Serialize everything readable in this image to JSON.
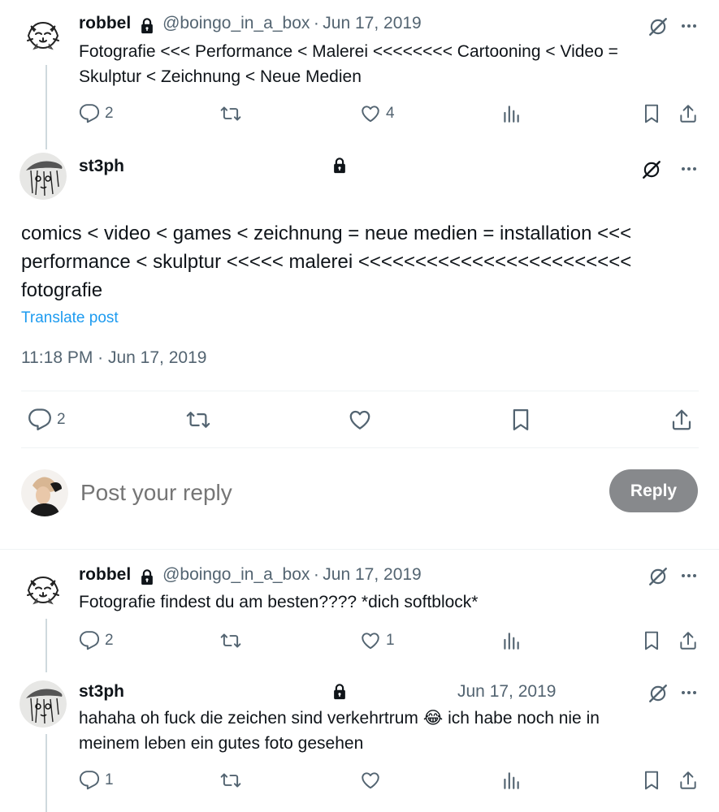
{
  "tweets": [
    {
      "name": "robbel",
      "handle": "@boingo_in_a_box",
      "sep": "·",
      "date": "Jun 17, 2019",
      "lines": [
        "Fotografie <<< Performance < Malerei <<<<<<<< Cartooning < Video =",
        "Skulptur < Zeichnung < Neue Medien"
      ],
      "replies": "2",
      "likes": "4"
    },
    {
      "name": "robbel",
      "handle": "@boingo_in_a_box",
      "sep": "·",
      "date": "Jun 17, 2019",
      "lines": [
        "Fotografie findest du am besten???? *dich softblock*"
      ],
      "replies": "2",
      "likes": "1"
    },
    {
      "name": "st3ph",
      "date": "Jun 17, 2019",
      "lines": [
        "hahaha oh fuck die zeichen sind verkehrtrum 😂 ich habe noch nie in",
        "meinem leben ein gutes foto gesehen"
      ],
      "replies": "1",
      "likes": ""
    }
  ],
  "main_post": {
    "name": "st3ph",
    "lines": [
      "comics < video < games < zeichnung = neue medien = installation <<<",
      "performance < skulptur <<<<< malerei <<<<<<<<<<<<<<<<<<<<<<<<",
      "fotografie"
    ],
    "translate": "Translate post",
    "timestamp": "11:18 PM · Jun 17, 2019",
    "replies": "2"
  },
  "composer": {
    "placeholder": "Post your reply",
    "button": "Reply"
  },
  "colors": {
    "text": "#0f1419",
    "muted": "#536471",
    "link": "#1d9bf0",
    "reply_button": "#87898c"
  },
  "icons": [
    "lock-icon",
    "grok-icon",
    "more-icon",
    "reply-icon",
    "retweet-icon",
    "like-icon",
    "views-icon",
    "bookmark-icon",
    "share-icon"
  ]
}
